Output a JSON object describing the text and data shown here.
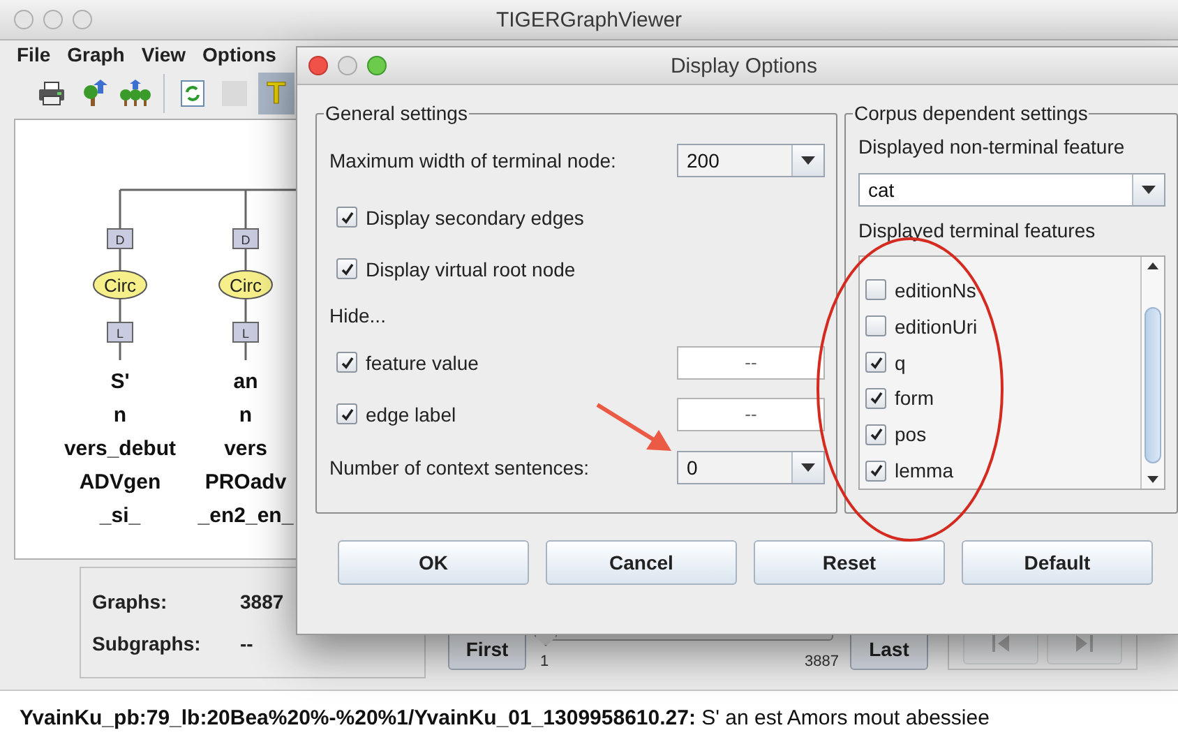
{
  "main_window": {
    "title": "TIGERGraphViewer"
  },
  "menu": [
    {
      "label": "File"
    },
    {
      "label": "Graph"
    },
    {
      "label": "View"
    },
    {
      "label": "Options"
    }
  ],
  "toolbar": [
    {
      "kind": "printer",
      "selected": false,
      "disabled": false
    },
    {
      "kind": "tree_up",
      "selected": false,
      "disabled": false
    },
    {
      "kind": "forest_up",
      "selected": false,
      "disabled": false
    },
    {
      "kind": "refresh",
      "selected": false,
      "disabled": false
    },
    {
      "kind": "blank",
      "selected": false,
      "disabled": true
    },
    {
      "kind": "glyph",
      "glyph": "T",
      "selected": true,
      "disabled": false
    }
  ],
  "graph": {
    "columns": [
      {
        "edge_top": "D",
        "node": "Circ",
        "edge_bottom": "L",
        "terminal": [
          "S'",
          "n",
          "vers_debut",
          "ADVgen",
          "_si_"
        ]
      },
      {
        "edge_top": "D",
        "node": "Circ",
        "edge_bottom": "L",
        "terminal": [
          "an",
          "n",
          "vers",
          "PROadv",
          "_en2_en_"
        ]
      }
    ]
  },
  "info": {
    "graphs_label": "Graphs:",
    "graphs_value": "3887",
    "subgraphs_label": "Subgraphs:",
    "subgraphs_value": "--"
  },
  "navigation": {
    "first": "First",
    "last": "Last",
    "slider": {
      "min_label": "1",
      "max_label": "3887",
      "level": 0
    },
    "match_buttons": [
      {
        "kind": "previous",
        "disabled": true
      },
      {
        "kind": "next",
        "disabled": true
      }
    ]
  },
  "status_bar": {
    "text": "**YvainKu_pb:79_lb:20Bea%20%-%20%1/YvainKu_01_1309958610.27:** S' an est Amors mout abessiee"
  },
  "dialog": {
    "title": "Display Options",
    "general": {
      "legend": "General settings",
      "max_width": {
        "label": "Maximum width of terminal node:",
        "value": "200"
      },
      "options": [
        {
          "label": "Display secondary edges",
          "checked": true
        },
        {
          "label": "Display virtual root node",
          "checked": true
        }
      ],
      "hide_label": "Hide...",
      "hide_options": [
        {
          "label": "feature value",
          "checked": true,
          "value": "--"
        },
        {
          "label": "edge label",
          "checked": true,
          "value": "--"
        }
      ],
      "context": {
        "label": "Number of context sentences:",
        "value": "0"
      }
    },
    "corpus": {
      "legend": "Corpus dependent settings",
      "nonterminal_label": "Displayed non-terminal feature",
      "nonterminal_value": "cat",
      "terminal_label": "Displayed terminal features",
      "terminal_features": [
        {
          "label": "editionNs",
          "checked": false
        },
        {
          "label": "editionUri",
          "checked": false
        },
        {
          "label": "q",
          "checked": true
        },
        {
          "label": "form",
          "checked": true
        },
        {
          "label": "pos",
          "checked": true
        },
        {
          "label": "lemma",
          "checked": true
        }
      ]
    },
    "buttons": [
      {
        "label": "OK"
      },
      {
        "label": "Cancel"
      },
      {
        "label": "Reset"
      },
      {
        "label": "Default"
      }
    ]
  }
}
